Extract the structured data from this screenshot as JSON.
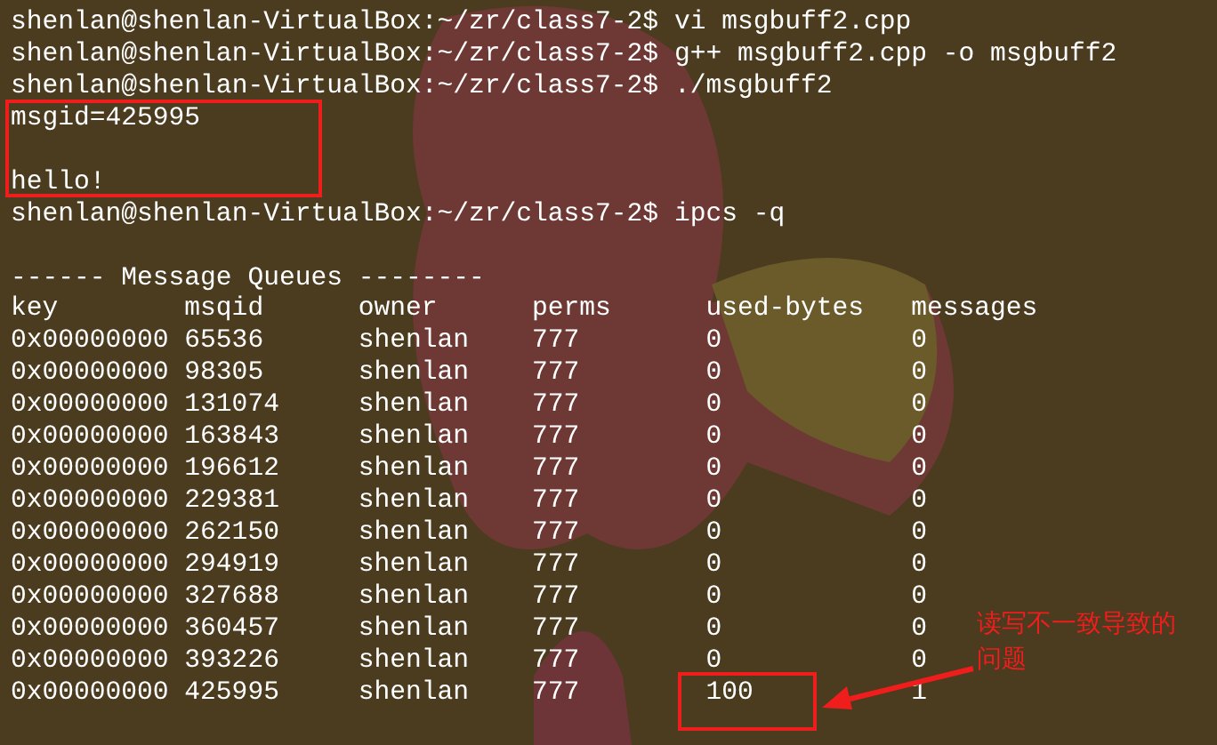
{
  "terminal": {
    "lines": [
      {
        "kind": "prompt",
        "prompt": "shenlan@shenlan-VirtualBox:~/zr/class7-2$",
        "command": "vi msgbuff2.cpp"
      },
      {
        "kind": "prompt",
        "prompt": "shenlan@shenlan-VirtualBox:~/zr/class7-2$",
        "command": "g++ msgbuff2.cpp -o msgbuff2"
      },
      {
        "kind": "prompt",
        "prompt": "shenlan@shenlan-VirtualBox:~/zr/class7-2$",
        "command": "./msgbuff2"
      },
      {
        "kind": "output",
        "text": "msgid=425995"
      },
      {
        "kind": "blank"
      },
      {
        "kind": "output",
        "text": "hello!"
      },
      {
        "kind": "prompt",
        "prompt": "shenlan@shenlan-VirtualBox:~/zr/class7-2$",
        "command": "ipcs -q"
      },
      {
        "kind": "blank"
      },
      {
        "kind": "output",
        "text": "------ Message Queues --------"
      }
    ],
    "ipcs_table": {
      "columns": [
        "key",
        "msqid",
        "owner",
        "perms",
        "used-bytes",
        "messages"
      ],
      "rows": [
        [
          "0x00000000",
          "65536",
          "shenlan",
          "777",
          "0",
          "0"
        ],
        [
          "0x00000000",
          "98305",
          "shenlan",
          "777",
          "0",
          "0"
        ],
        [
          "0x00000000",
          "131074",
          "shenlan",
          "777",
          "0",
          "0"
        ],
        [
          "0x00000000",
          "163843",
          "shenlan",
          "777",
          "0",
          "0"
        ],
        [
          "0x00000000",
          "196612",
          "shenlan",
          "777",
          "0",
          "0"
        ],
        [
          "0x00000000",
          "229381",
          "shenlan",
          "777",
          "0",
          "0"
        ],
        [
          "0x00000000",
          "262150",
          "shenlan",
          "777",
          "0",
          "0"
        ],
        [
          "0x00000000",
          "294919",
          "shenlan",
          "777",
          "0",
          "0"
        ],
        [
          "0x00000000",
          "327688",
          "shenlan",
          "777",
          "0",
          "0"
        ],
        [
          "0x00000000",
          "360457",
          "shenlan",
          "777",
          "0",
          "0"
        ],
        [
          "0x00000000",
          "393226",
          "shenlan",
          "777",
          "0",
          "0"
        ],
        [
          "0x00000000",
          "425995",
          "shenlan",
          "777",
          "100",
          "1"
        ]
      ]
    }
  },
  "annotation": {
    "note": "读写不一致导致的问题"
  }
}
